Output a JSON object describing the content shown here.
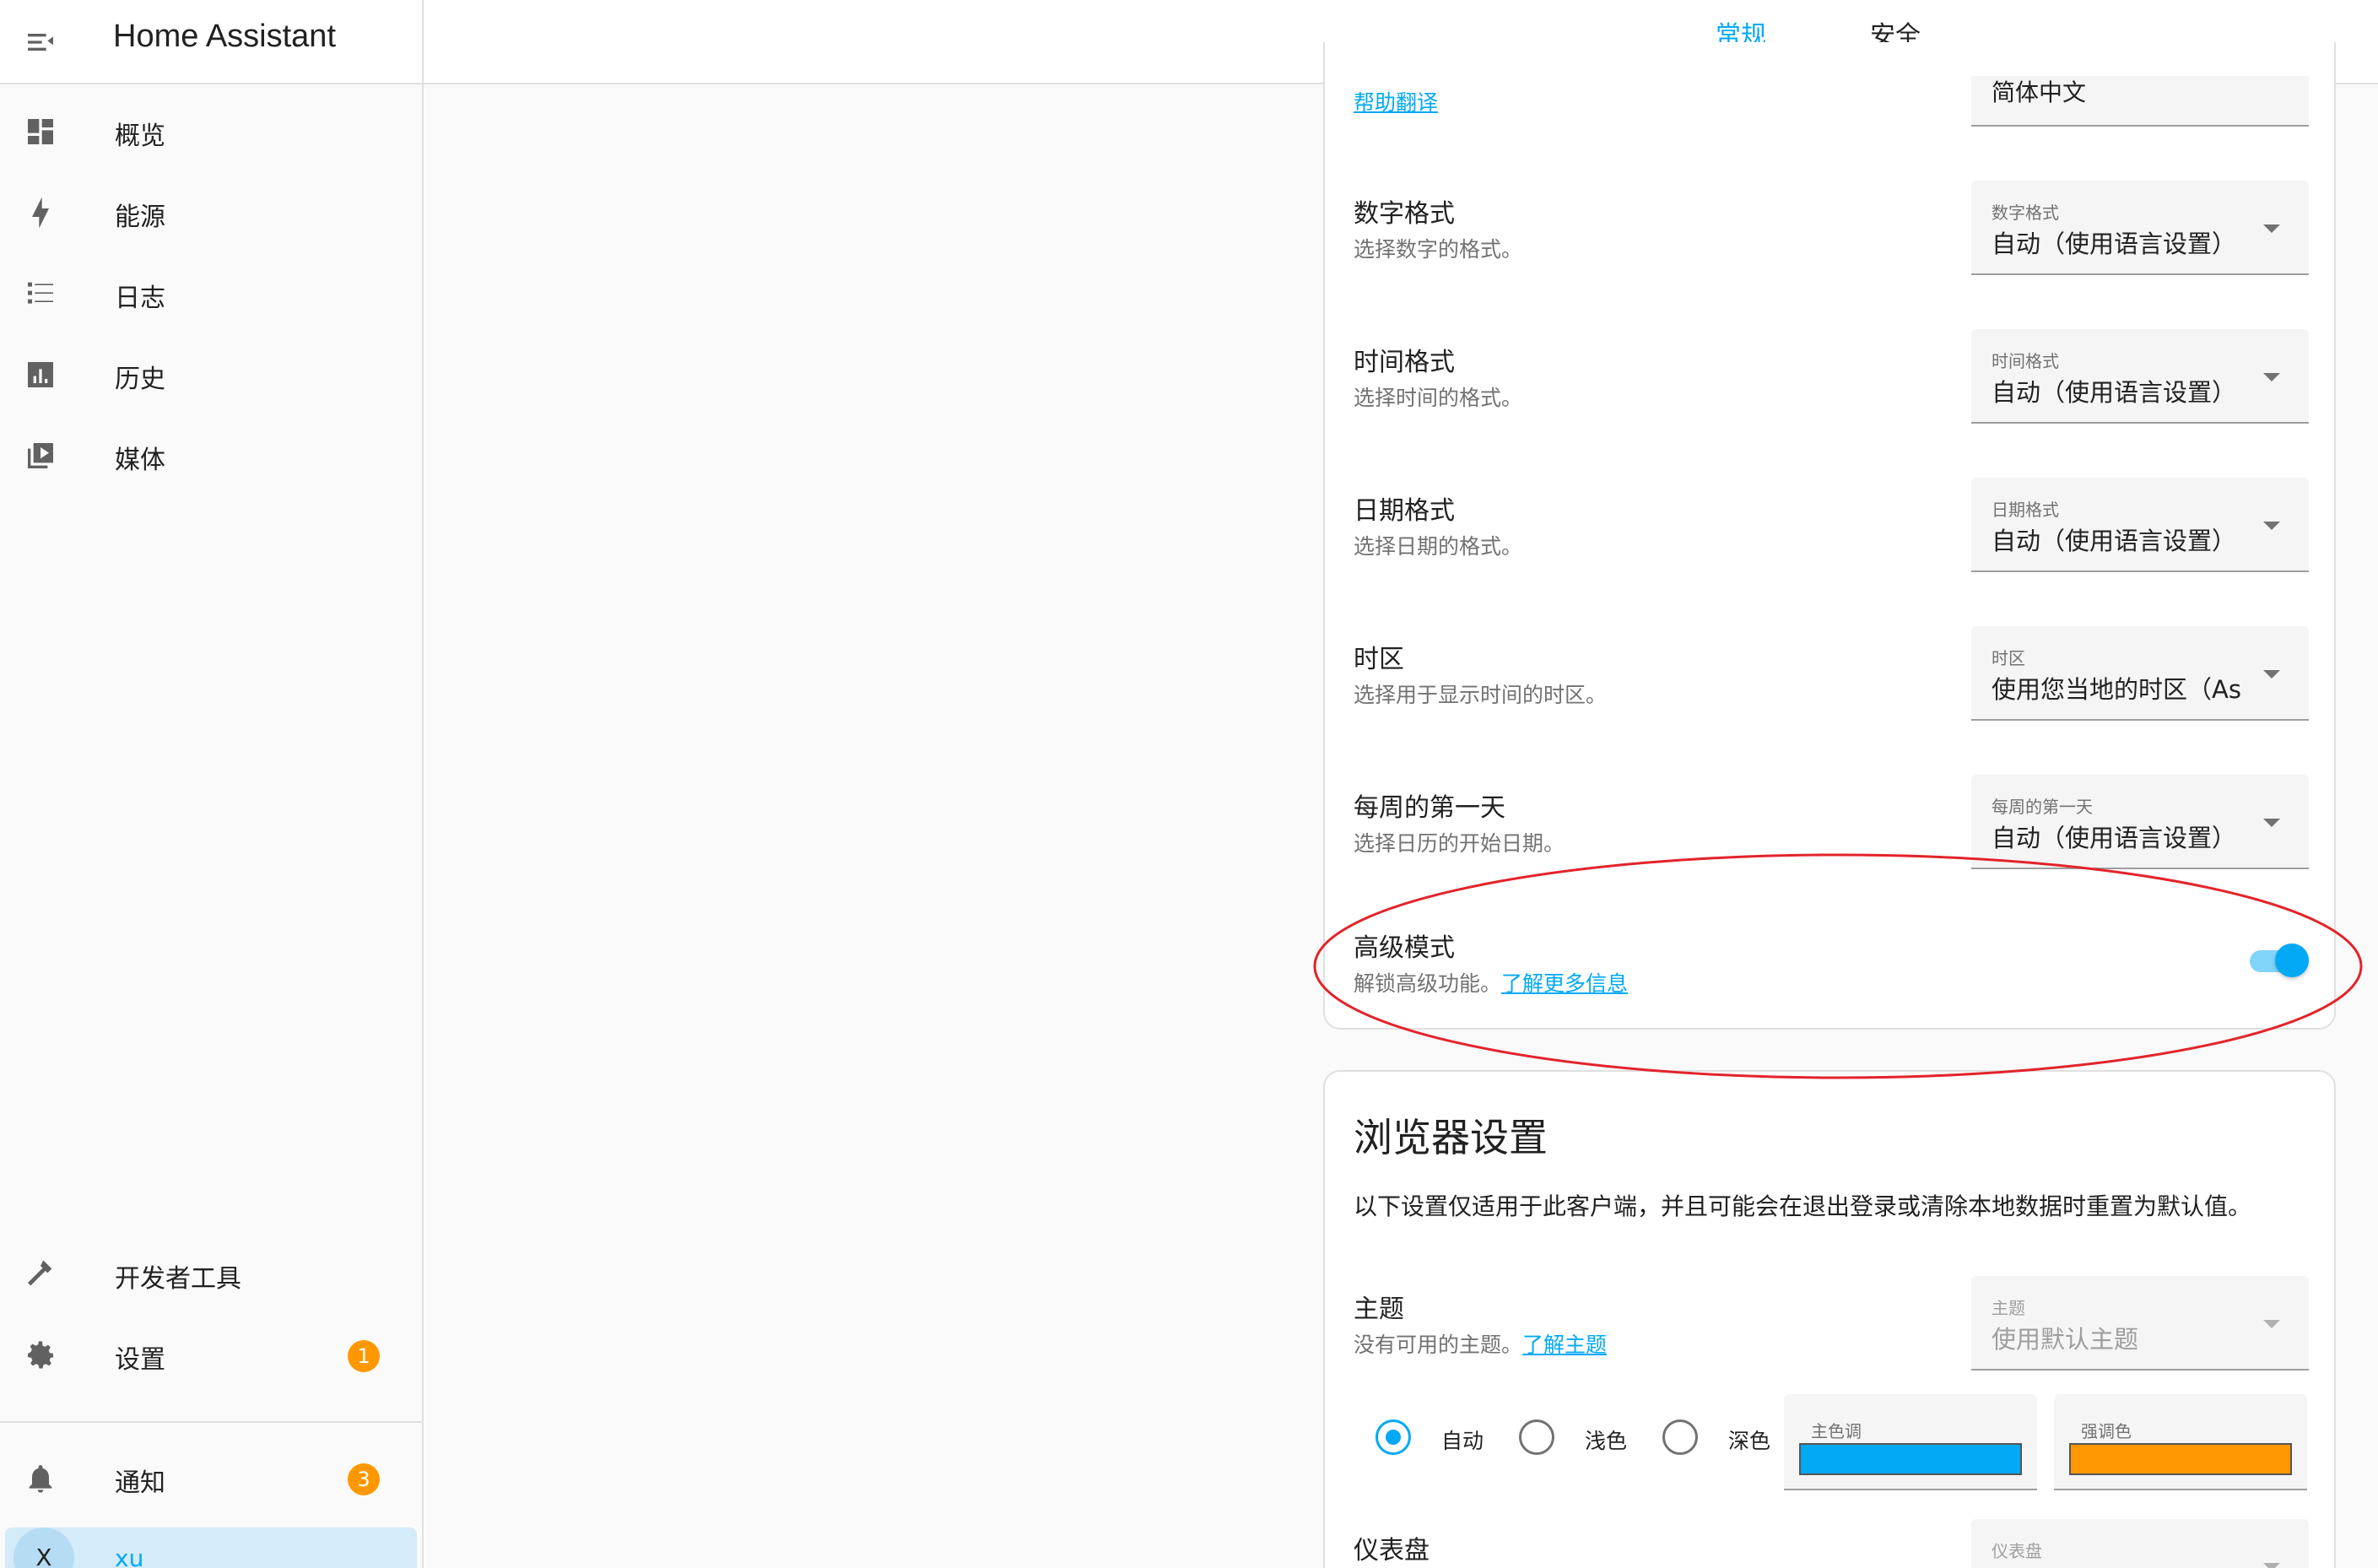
{
  "app": {
    "title": "Home Assistant"
  },
  "sidebar": {
    "items": [
      {
        "label": "概览",
        "icon": "dashboard-icon"
      },
      {
        "label": "能源",
        "icon": "lightning-bolt-icon"
      },
      {
        "label": "日志",
        "icon": "list-icon"
      },
      {
        "label": "历史",
        "icon": "chart-box-icon"
      },
      {
        "label": "媒体",
        "icon": "play-box-icon"
      }
    ],
    "bottom_items": [
      {
        "label": "开发者工具",
        "icon": "hammer-icon"
      },
      {
        "label": "设置",
        "icon": "cog-icon",
        "badge": "1"
      }
    ],
    "notifications": {
      "label": "通知",
      "icon": "bell-icon",
      "badge": "3"
    },
    "user": {
      "initial": "X",
      "name": "xu"
    }
  },
  "tabs": [
    {
      "label": "常规",
      "active": true
    },
    {
      "label": "安全",
      "active": false
    }
  ],
  "general": {
    "help_translate": "帮助翻译",
    "language_value": "简体中文",
    "rows": [
      {
        "title": "数字格式",
        "desc": "选择数字的格式。",
        "select_label": "数字格式",
        "select_value": "自动（使用语言设置）"
      },
      {
        "title": "时间格式",
        "desc": "选择时间的格式。",
        "select_label": "时间格式",
        "select_value": "自动（使用语言设置）"
      },
      {
        "title": "日期格式",
        "desc": "选择日期的格式。",
        "select_label": "日期格式",
        "select_value": "自动（使用语言设置）"
      },
      {
        "title": "时区",
        "desc": "选择用于显示时间的时区。",
        "select_label": "时区",
        "select_value": "使用您当地的时区（As"
      },
      {
        "title": "每周的第一天",
        "desc": "选择日历的开始日期。",
        "select_label": "每周的第一天",
        "select_value": "自动（使用语言设置）"
      }
    ],
    "advanced": {
      "title": "高级模式",
      "desc": "解锁高级功能。",
      "link": "了解更多信息",
      "enabled": true
    }
  },
  "browser": {
    "title": "浏览器设置",
    "desc": "以下设置仅适用于此客户端，并且可能会在退出登录或清除本地数据时重置为默认值。",
    "theme": {
      "title": "主题",
      "desc": "没有可用的主题。",
      "link": "了解主题",
      "select_label": "主题",
      "select_value": "使用默认主题"
    },
    "modes": [
      {
        "label": "自动",
        "checked": true
      },
      {
        "label": "浅色",
        "checked": false
      },
      {
        "label": "深色",
        "checked": false
      }
    ],
    "primary_color": {
      "label": "主色调",
      "value": "#03a9f4"
    },
    "accent_color": {
      "label": "强调色",
      "value": "#ff9800"
    },
    "dashboard": {
      "title": "仪表盘",
      "select_label": "仪表盘"
    }
  },
  "colors": {
    "accent": "#03a9f4",
    "badge": "#ff9800",
    "annotation": "#e3232a"
  }
}
